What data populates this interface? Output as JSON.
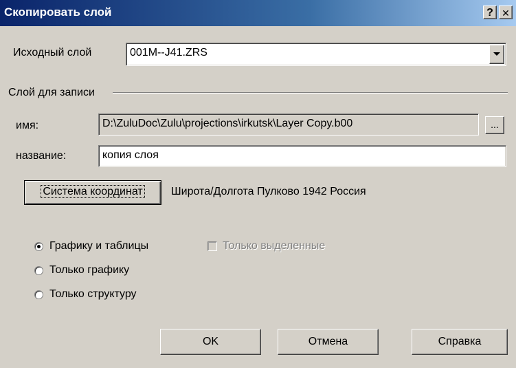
{
  "window": {
    "title": "Скопировать слой",
    "help_button": "?",
    "close_button": "✕"
  },
  "source": {
    "label": "Исходный слой",
    "value": "001M--J41.ZRS"
  },
  "target_group": {
    "label": "Слой для записи",
    "name_label": "имя:",
    "name_value": "D:\\ZuluDoc\\Zulu\\projections\\irkutsk\\Layer Copy.b00",
    "browse_button": "...",
    "title_label": "название:",
    "title_value": "копия слоя"
  },
  "coords": {
    "button": "Система координат",
    "value": "Широта/Долгота Пулково 1942 Россия"
  },
  "options": {
    "radio_graphics_tables": "Графику и таблицы",
    "radio_graphics_only": "Только графику",
    "radio_structure_only": "Только структуру",
    "selected": "graphics_tables",
    "checkbox_selected_only": "Только выделенные",
    "checkbox_checked": false,
    "checkbox_enabled": false
  },
  "buttons": {
    "ok": "OK",
    "cancel": "Отмена",
    "help": "Справка"
  }
}
